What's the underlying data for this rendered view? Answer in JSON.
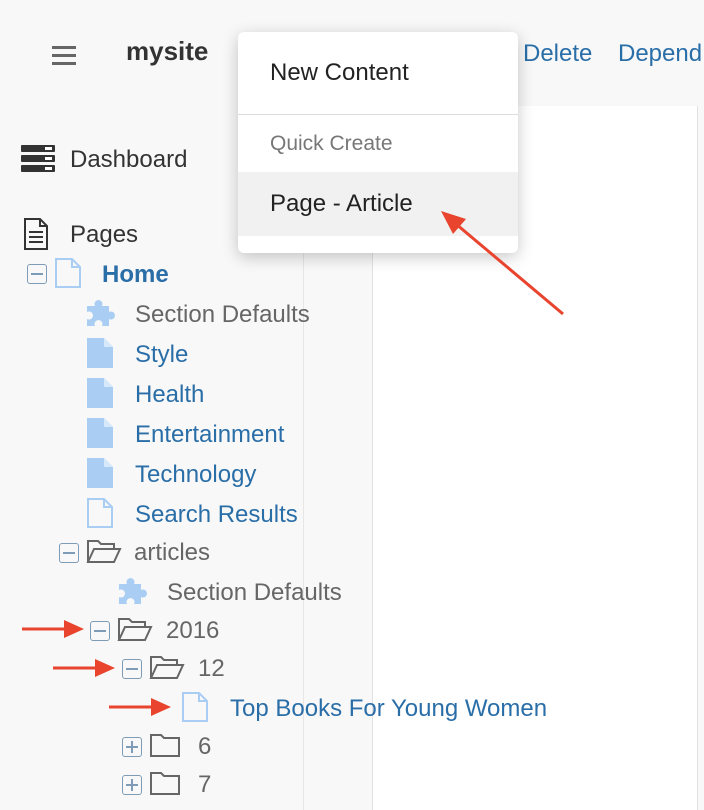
{
  "header": {
    "site_name": "mysite",
    "toolbar_links": [
      "Delete",
      "Depend"
    ]
  },
  "sidebar": {
    "dashboard_label": "Dashboard",
    "pages_label": "Pages"
  },
  "tree": {
    "home": "Home",
    "section_defaults": "Section Defaults",
    "style": "Style",
    "health": "Health",
    "entertainment": "Entertainment",
    "technology": "Technology",
    "search_results": "Search Results",
    "articles": "articles",
    "articles_section_defaults": "Section Defaults",
    "year_2016": "2016",
    "month_12": "12",
    "article_title": "Top Books For Young Women",
    "month_6": "6",
    "month_7": "7"
  },
  "menu": {
    "new_content": "New Content",
    "quick_create_header": "Quick Create",
    "page_article": "Page - Article"
  },
  "colors": {
    "link": "#2a6ea8",
    "icon_blue": "#a9cdf3",
    "arrow": "#e8442e"
  },
  "icons": [
    "hamburger-icon",
    "dashboard-icon",
    "pages-icon",
    "page-icon",
    "puzzle-icon",
    "folder-open-icon",
    "folder-icon",
    "arrow-icon"
  ]
}
